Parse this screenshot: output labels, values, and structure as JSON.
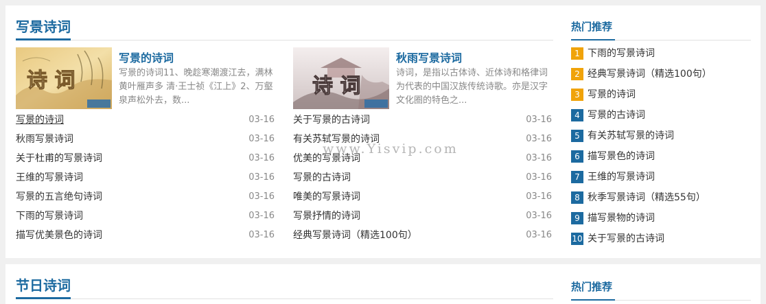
{
  "section1": {
    "title": "写景诗词",
    "featured": [
      {
        "title": "写景的诗词",
        "desc": "写景的诗词11、晚趁寒潮渡江去，满林黄叶雁声多 清·王士祯《江上》2、万壑泉声松外去，数...",
        "thumb_text": "诗 词"
      },
      {
        "title": "秋雨写景诗词",
        "desc": "诗词，是指以古体诗、近体诗和格律词为代表的中国汉族传统诗歌。亦是汉字文化圈的特色之...",
        "thumb_text": "诗 词"
      }
    ],
    "list_left": [
      {
        "title": "写景的诗词",
        "date": "03-16"
      },
      {
        "title": "秋雨写景诗词",
        "date": "03-16"
      },
      {
        "title": "关于杜甫的写景诗词",
        "date": "03-16"
      },
      {
        "title": "王维的写景诗词",
        "date": "03-16"
      },
      {
        "title": "写景的五言绝句诗词",
        "date": "03-16"
      },
      {
        "title": "下雨的写景诗词",
        "date": "03-16"
      },
      {
        "title": "描写优美景色的诗词",
        "date": "03-16"
      }
    ],
    "list_right": [
      {
        "title": "关于写景的古诗词",
        "date": "03-16"
      },
      {
        "title": "有关苏轼写景的诗词",
        "date": "03-16"
      },
      {
        "title": "优美的写景诗词",
        "date": "03-16"
      },
      {
        "title": "写景的古诗词",
        "date": "03-16"
      },
      {
        "title": "唯美的写景诗词",
        "date": "03-16"
      },
      {
        "title": "写景抒情的诗词",
        "date": "03-16"
      },
      {
        "title": "经典写景诗词（精选100句）",
        "date": "03-16"
      }
    ]
  },
  "sidebar1": {
    "title": "热门推荐",
    "items": [
      {
        "num": "1",
        "title": "下雨的写景诗词"
      },
      {
        "num": "2",
        "title": "经典写景诗词（精选100句）"
      },
      {
        "num": "3",
        "title": "写景的诗词"
      },
      {
        "num": "4",
        "title": "写景的古诗词"
      },
      {
        "num": "5",
        "title": "有关苏轼写景的诗词"
      },
      {
        "num": "6",
        "title": "描写景色的诗词"
      },
      {
        "num": "7",
        "title": "王维的写景诗词"
      },
      {
        "num": "8",
        "title": "秋季写景诗词（精选55句）"
      },
      {
        "num": "9",
        "title": "描写景物的诗词"
      },
      {
        "num": "10",
        "title": "关于写景的古诗词"
      }
    ]
  },
  "section2": {
    "title": "节日诗词"
  },
  "sidebar2": {
    "title": "热门推荐"
  },
  "watermark": "www.Yisvip.com",
  "colors": {
    "accent": "#1c6aa0",
    "rank_top": "#f0a30a",
    "rank_rest": "#1c6aa0"
  }
}
